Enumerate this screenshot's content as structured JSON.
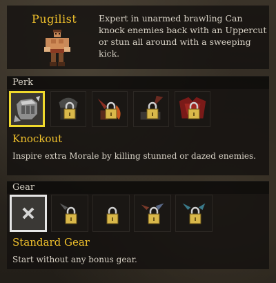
{
  "hero": {
    "name": "Pugilist",
    "description": "Expert in unarmed brawling Can knock enemies back with an Uppercut or stun all around with a sweeping kick."
  },
  "perk_section": {
    "header": "Perk",
    "selected_title": "Knockout",
    "selected_description": "Inspire extra Morale by killing stunned or dazed enemies.",
    "slots": [
      {
        "name": "knockout-perk",
        "locked": false,
        "selected": true
      },
      {
        "name": "locked-perk-2",
        "locked": true,
        "selected": false
      },
      {
        "name": "locked-perk-3",
        "locked": true,
        "selected": false
      },
      {
        "name": "locked-perk-4",
        "locked": true,
        "selected": false
      },
      {
        "name": "locked-perk-5",
        "locked": true,
        "selected": false
      }
    ]
  },
  "gear_section": {
    "header": "Gear",
    "selected_title": "Standard Gear",
    "selected_description": "Start without any bonus gear.",
    "slots": [
      {
        "name": "standard-gear",
        "locked": false,
        "selected": true
      },
      {
        "name": "locked-gear-2",
        "locked": true,
        "selected": false
      },
      {
        "name": "locked-gear-3",
        "locked": true,
        "selected": false
      },
      {
        "name": "locked-gear-4",
        "locked": true,
        "selected": false
      },
      {
        "name": "locked-gear-5",
        "locked": true,
        "selected": false
      }
    ]
  },
  "colors": {
    "accent_gold": "#f0c12c",
    "selection_yellow": "#f0d92c",
    "selection_white": "#e6e6e6",
    "body_text": "#d8d2c6"
  }
}
